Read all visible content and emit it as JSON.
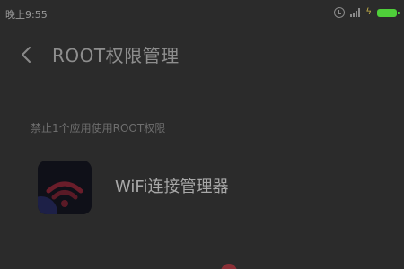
{
  "status_bar": {
    "time": "晚上9:55",
    "icons": [
      "alarm-icon",
      "signal-icon",
      "charging-icon",
      "battery-icon"
    ],
    "battery_color": "#4fcf3a"
  },
  "header": {
    "back_icon": "chevron-left-icon",
    "title": "ROOT权限管理"
  },
  "section": {
    "label": "禁止1个应用使用ROOT权限"
  },
  "apps": [
    {
      "name": "WiFi连接管理器",
      "icon": "wifi-app-icon",
      "icon_colors": [
        "#0f1018",
        "#6a1d2a",
        "#3a3fa0"
      ]
    }
  ],
  "colors": {
    "background": "#2b2b2b",
    "title_text": "#8e8e8e",
    "secondary_text": "#6e6e6e"
  }
}
